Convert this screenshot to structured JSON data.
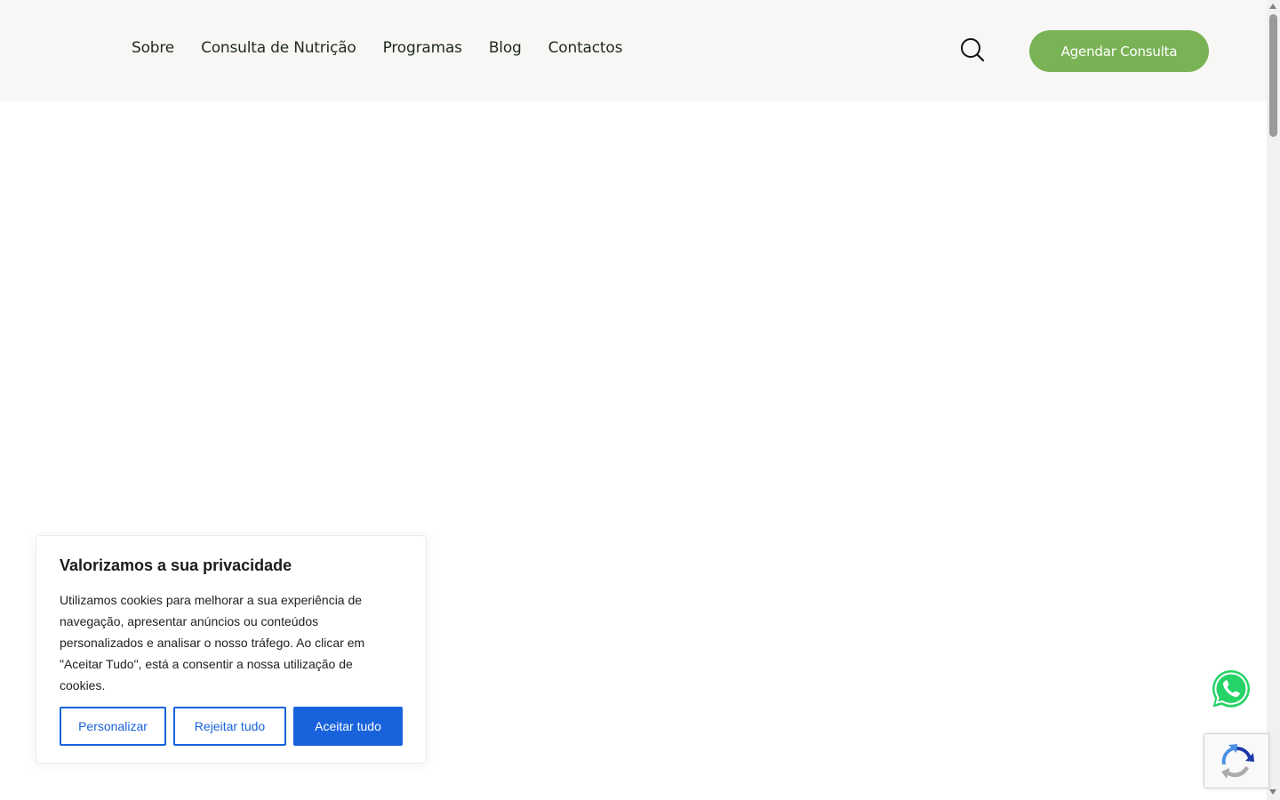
{
  "header": {
    "nav": [
      {
        "label": "Sobre"
      },
      {
        "label": "Consulta de Nutrição"
      },
      {
        "label": "Programas"
      },
      {
        "label": "Blog"
      },
      {
        "label": "Contactos"
      }
    ],
    "search_icon": "search-icon",
    "cta_label": "Agendar Consulta"
  },
  "cookie_banner": {
    "title": "Valorizamos a sua privacidade",
    "text": "Utilizamos cookies para melhorar a sua experiência de navegação, apresentar anúncios ou conteúdos personalizados e analisar o nosso tráfego. Ao clicar em \"Aceitar Tudo\", está a consentir a nossa utilização de cookies.",
    "buttons": {
      "customize": "Personalizar",
      "reject": "Rejeitar tudo",
      "accept": "Aceitar tudo"
    }
  },
  "floating": {
    "whatsapp_icon": "whatsapp-icon",
    "recaptcha_icon": "recaptcha-icon"
  },
  "colors": {
    "header_bg": "#f8f7f5",
    "accent_green": "#7ab356",
    "consent_blue": "#1863dc",
    "whatsapp_green": "#25d366"
  }
}
